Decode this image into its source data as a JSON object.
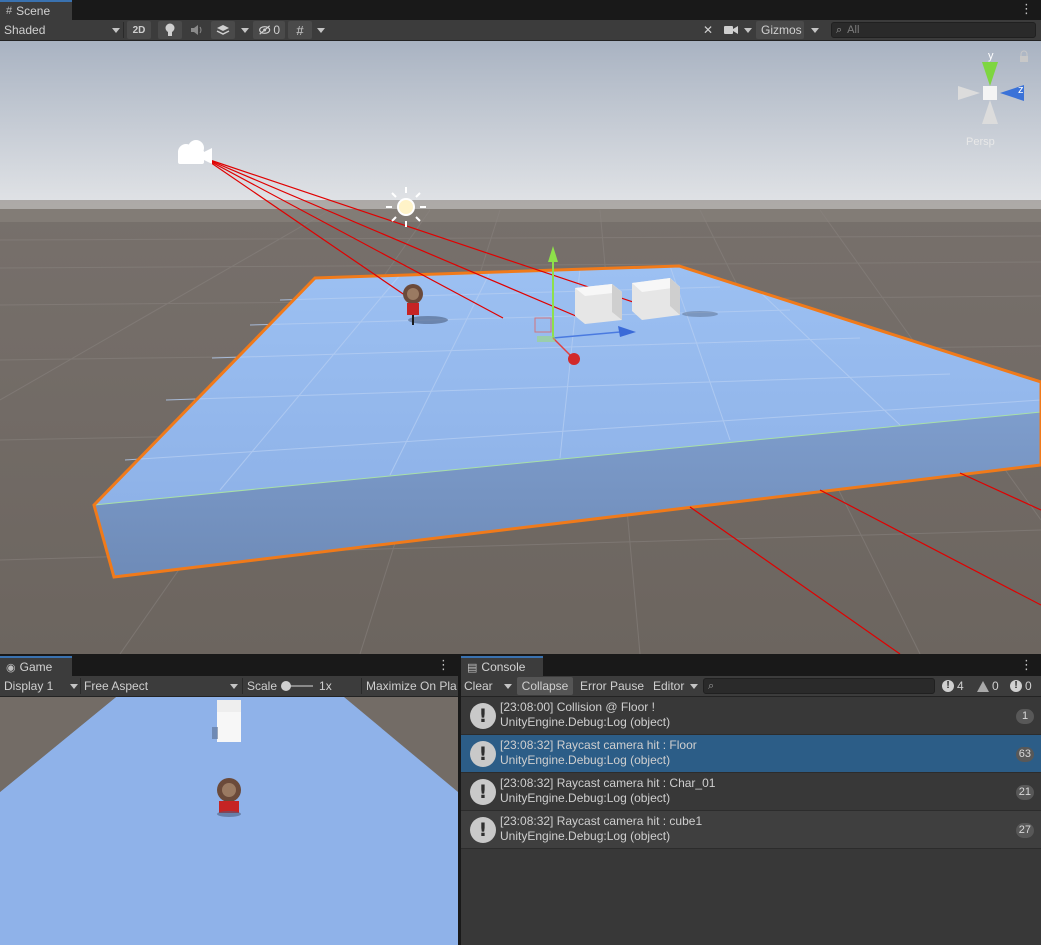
{
  "scene": {
    "tab_label": "Scene",
    "toolbar": {
      "shading_mode": "Shaded",
      "mode_2d": "2D",
      "hidden_count": "0",
      "gizmos_label": "Gizmos",
      "search_placeholder": "All"
    },
    "gizmo": {
      "axis_y": "y",
      "axis_z": "z",
      "projection": "Persp"
    }
  },
  "game": {
    "tab_label": "Game",
    "display": "Display 1",
    "aspect": "Free Aspect",
    "scale_label": "Scale",
    "scale_value": "1x",
    "maximize_label": "Maximize On Pla"
  },
  "console": {
    "tab_label": "Console",
    "clear_label": "Clear",
    "collapse_label": "Collapse",
    "error_pause_label": "Error Pause",
    "editor_label": "Editor",
    "counts": {
      "warnings": "4",
      "alerts": "0",
      "errors": "0"
    },
    "logs": [
      {
        "message": "[23:08:00] Collision @ Floor !",
        "detail": "UnityEngine.Debug:Log (object)",
        "count": "1",
        "selected": false
      },
      {
        "message": "[23:08:32] Raycast camera hit : Floor",
        "detail": "UnityEngine.Debug:Log (object)",
        "count": "63",
        "selected": true
      },
      {
        "message": "[23:08:32] Raycast camera hit : Char_01",
        "detail": "UnityEngine.Debug:Log (object)",
        "count": "21",
        "selected": false
      },
      {
        "message": "[23:08:32] Raycast camera hit : cube1",
        "detail": "UnityEngine.Debug:Log (object)",
        "count": "27",
        "selected": false
      }
    ]
  },
  "colors": {
    "selection_outline": "#f07a1a",
    "selected_row": "#2c5d87",
    "floor": "#8fb3ea",
    "ray": "#e00000"
  }
}
